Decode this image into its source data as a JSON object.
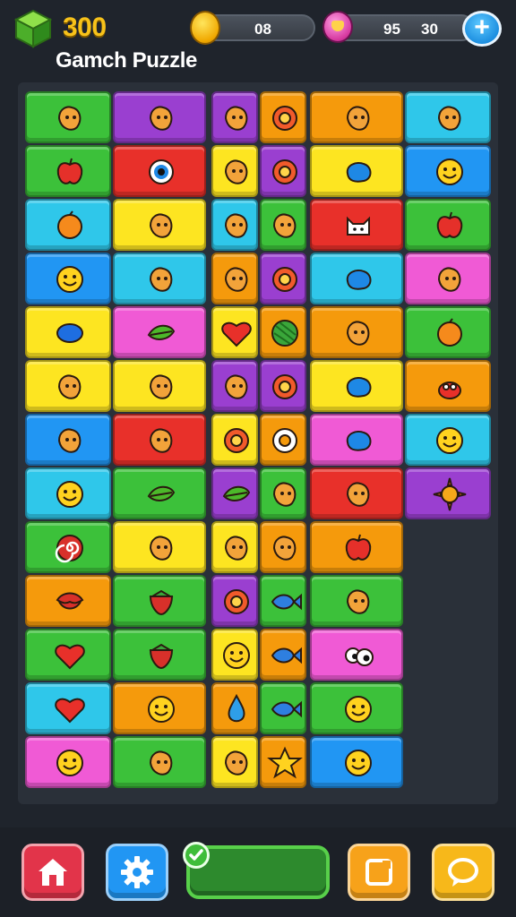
{
  "header": {
    "score": "300",
    "title": "Gamch Puzzle",
    "coins": "08",
    "gems": "95",
    "gems_extra": "30",
    "score_icon": "green-cube-icon",
    "coin_icon": "coin-icon",
    "gem_icon": "gem-icon",
    "add_icon": "plus-icon"
  },
  "colors": {
    "background": "#1f242c",
    "score": "#f7c21a",
    "red": "#e8302a",
    "green": "#3cc13a",
    "blue": "#2196f3",
    "cyan": "#2fc7ea",
    "yellow": "#fde521",
    "orange": "#f59a0c",
    "purple": "#9a3fd0",
    "pink": "#f05ad5"
  },
  "board": {
    "columns": 6,
    "rows": 13,
    "tiles": [
      {
        "row": 0,
        "col": 0,
        "span": 1,
        "color": "green",
        "icon": "face-box-icon"
      },
      {
        "row": 0,
        "col": 1,
        "span": 1,
        "color": "purple",
        "icon": "leaf-creature-icon"
      },
      {
        "row": 0,
        "col": 2,
        "span": 1,
        "color": "purple",
        "icon": "bug-icon"
      },
      {
        "row": 0,
        "col": 3,
        "span": 1,
        "color": "orange",
        "icon": "ring-icon"
      },
      {
        "row": 0,
        "col": 4,
        "span": 1,
        "color": "orange",
        "icon": "ice-cream-icon"
      },
      {
        "row": 0,
        "col": 5,
        "span": 1,
        "color": "cyan",
        "icon": "monkey-icon"
      },
      {
        "row": 1,
        "col": 0,
        "span": 1,
        "color": "green",
        "icon": "apple-icon"
      },
      {
        "row": 1,
        "col": 1,
        "span": 1,
        "color": "red",
        "icon": "eye-icon"
      },
      {
        "row": 1,
        "col": 2,
        "span": 1,
        "color": "yellow",
        "icon": "key-icon"
      },
      {
        "row": 1,
        "col": 3,
        "span": 1,
        "color": "purple",
        "icon": "ring-icon"
      },
      {
        "row": 1,
        "col": 4,
        "span": 1,
        "color": "yellow",
        "icon": "blob-icon"
      },
      {
        "row": 1,
        "col": 5,
        "span": 1,
        "color": "blue",
        "icon": "smiley-icon"
      },
      {
        "row": 2,
        "col": 0,
        "span": 1,
        "color": "cyan",
        "icon": "orange-fruit-icon"
      },
      {
        "row": 2,
        "col": 1,
        "span": 1,
        "color": "yellow",
        "icon": "banana-icon"
      },
      {
        "row": 2,
        "col": 2,
        "span": 1,
        "color": "cyan",
        "icon": "berry-icon"
      },
      {
        "row": 2,
        "col": 3,
        "span": 1,
        "color": "green",
        "icon": "yarn-ball-icon"
      },
      {
        "row": 2,
        "col": 4,
        "span": 1,
        "color": "red",
        "icon": "cat-icon"
      },
      {
        "row": 2,
        "col": 5,
        "span": 1,
        "color": "green",
        "icon": "apple-icon"
      },
      {
        "row": 3,
        "col": 0,
        "span": 1,
        "color": "blue",
        "icon": "smiley-icon"
      },
      {
        "row": 3,
        "col": 1,
        "span": 1,
        "color": "cyan",
        "icon": "paper-clip-icon"
      },
      {
        "row": 3,
        "col": 2,
        "span": 1,
        "color": "orange",
        "icon": "bomb-icon"
      },
      {
        "row": 3,
        "col": 3,
        "span": 1,
        "color": "purple",
        "icon": "ring-icon"
      },
      {
        "row": 3,
        "col": 4,
        "span": 1,
        "color": "cyan",
        "icon": "blob-icon"
      },
      {
        "row": 3,
        "col": 5,
        "span": 1,
        "color": "pink",
        "icon": "green-monster-icon"
      },
      {
        "row": 4,
        "col": 0,
        "span": 1,
        "color": "yellow",
        "icon": "bean-icon"
      },
      {
        "row": 4,
        "col": 1,
        "span": 1,
        "color": "pink",
        "icon": "leaf-icon"
      },
      {
        "row": 4,
        "col": 2,
        "span": 1,
        "color": "yellow",
        "icon": "heart-icon"
      },
      {
        "row": 4,
        "col": 3,
        "span": 1,
        "color": "orange",
        "icon": "melon-icon"
      },
      {
        "row": 4,
        "col": 4,
        "span": 1,
        "color": "orange",
        "icon": "lemon-icon"
      },
      {
        "row": 4,
        "col": 5,
        "span": 1,
        "color": "green",
        "icon": "orange-fruit-icon"
      },
      {
        "row": 5,
        "col": 0,
        "span": 1,
        "color": "yellow",
        "icon": "feather-icon"
      },
      {
        "row": 5,
        "col": 1,
        "span": 1,
        "color": "yellow",
        "icon": "flower-icon"
      },
      {
        "row": 5,
        "col": 2,
        "span": 1,
        "color": "purple",
        "icon": "bucket-icon"
      },
      {
        "row": 5,
        "col": 3,
        "span": 1,
        "color": "purple",
        "icon": "ring-icon"
      },
      {
        "row": 5,
        "col": 4,
        "span": 1,
        "color": "yellow",
        "icon": "blob-icon"
      },
      {
        "row": 5,
        "col": 5,
        "span": 1,
        "color": "orange",
        "icon": "crab-icon"
      },
      {
        "row": 6,
        "col": 0,
        "span": 1,
        "color": "blue",
        "icon": "spiky-bug-icon"
      },
      {
        "row": 6,
        "col": 1,
        "span": 1,
        "color": "red",
        "icon": "bell-icon"
      },
      {
        "row": 6,
        "col": 2,
        "span": 1,
        "color": "yellow",
        "icon": "ring-icon"
      },
      {
        "row": 6,
        "col": 3,
        "span": 1,
        "color": "orange",
        "icon": "target-icon"
      },
      {
        "row": 6,
        "col": 4,
        "span": 1,
        "color": "pink",
        "icon": "blob-icon"
      },
      {
        "row": 6,
        "col": 5,
        "span": 1,
        "color": "cyan",
        "icon": "smiley-icon"
      },
      {
        "row": 7,
        "col": 0,
        "span": 1,
        "color": "cyan",
        "icon": "smiley-icon"
      },
      {
        "row": 7,
        "col": 1,
        "span": 1,
        "color": "green",
        "icon": "leaf-icon"
      },
      {
        "row": 7,
        "col": 2,
        "span": 1,
        "color": "purple",
        "icon": "leaf-icon"
      },
      {
        "row": 7,
        "col": 3,
        "span": 1,
        "color": "green",
        "icon": "berry-icon"
      },
      {
        "row": 7,
        "col": 4,
        "span": 1,
        "color": "red",
        "icon": "lion-icon"
      },
      {
        "row": 7,
        "col": 5,
        "span": 1,
        "color": "purple",
        "icon": "sun-icon"
      },
      {
        "row": 8,
        "col": 0,
        "span": 1,
        "color": "green",
        "icon": "swirl-icon"
      },
      {
        "row": 8,
        "col": 1,
        "span": 1,
        "color": "yellow",
        "icon": "starfruit-icon"
      },
      {
        "row": 8,
        "col": 2,
        "span": 1,
        "color": "yellow",
        "icon": "sausage-icon"
      },
      {
        "row": 8,
        "col": 3,
        "span": 1,
        "color": "orange",
        "icon": "pineapple-icon"
      },
      {
        "row": 8,
        "col": 4,
        "span": 1,
        "color": "orange",
        "icon": "apple-icon"
      },
      {
        "row": 9,
        "col": 0,
        "span": 1,
        "color": "orange",
        "icon": "lips-icon"
      },
      {
        "row": 9,
        "col": 1,
        "span": 1,
        "color": "green",
        "icon": "strawberry-icon"
      },
      {
        "row": 9,
        "col": 2,
        "span": 1,
        "color": "purple",
        "icon": "ring-icon"
      },
      {
        "row": 9,
        "col": 3,
        "span": 1,
        "color": "green",
        "icon": "fish-icon"
      },
      {
        "row": 9,
        "col": 4,
        "span": 1,
        "color": "green",
        "icon": "purple-monster-icon"
      },
      {
        "row": 10,
        "col": 0,
        "span": 1,
        "color": "green",
        "icon": "heart-icon"
      },
      {
        "row": 10,
        "col": 1,
        "span": 1,
        "color": "green",
        "icon": "strawberry-icon"
      },
      {
        "row": 10,
        "col": 2,
        "span": 1,
        "color": "yellow",
        "icon": "smiley-icon"
      },
      {
        "row": 10,
        "col": 3,
        "span": 1,
        "color": "orange",
        "icon": "fish-icon"
      },
      {
        "row": 10,
        "col": 4,
        "span": 1,
        "color": "pink",
        "icon": "eyes-icon"
      },
      {
        "row": 11,
        "col": 0,
        "span": 1,
        "color": "cyan",
        "icon": "heart-icon"
      },
      {
        "row": 11,
        "col": 1,
        "span": 1,
        "color": "orange",
        "icon": "smiley-icon"
      },
      {
        "row": 11,
        "col": 2,
        "span": 1,
        "color": "orange",
        "icon": "water-drop-icon"
      },
      {
        "row": 11,
        "col": 3,
        "span": 1,
        "color": "green",
        "icon": "fish-icon"
      },
      {
        "row": 11,
        "col": 4,
        "span": 1,
        "color": "green",
        "icon": "smiley-icon"
      },
      {
        "row": 12,
        "col": 0,
        "span": 1,
        "color": "pink",
        "icon": "smiley-icon"
      },
      {
        "row": 12,
        "col": 1,
        "span": 1,
        "color": "green",
        "icon": "palm-leaf-icon"
      },
      {
        "row": 12,
        "col": 2,
        "span": 1,
        "color": "yellow",
        "icon": "candy-icon"
      },
      {
        "row": 12,
        "col": 3,
        "span": 1,
        "color": "orange",
        "icon": "star-icon"
      },
      {
        "row": 12,
        "col": 4,
        "span": 1,
        "color": "blue",
        "icon": "smiley-icon"
      }
    ]
  },
  "bottom_bar": {
    "home_icon": "home-icon",
    "settings_icon": "gear-icon",
    "progress": 0.0,
    "progress_check_icon": "check-icon",
    "card_icon": "card-icon",
    "chat_icon": "chat-bubble-icon"
  }
}
